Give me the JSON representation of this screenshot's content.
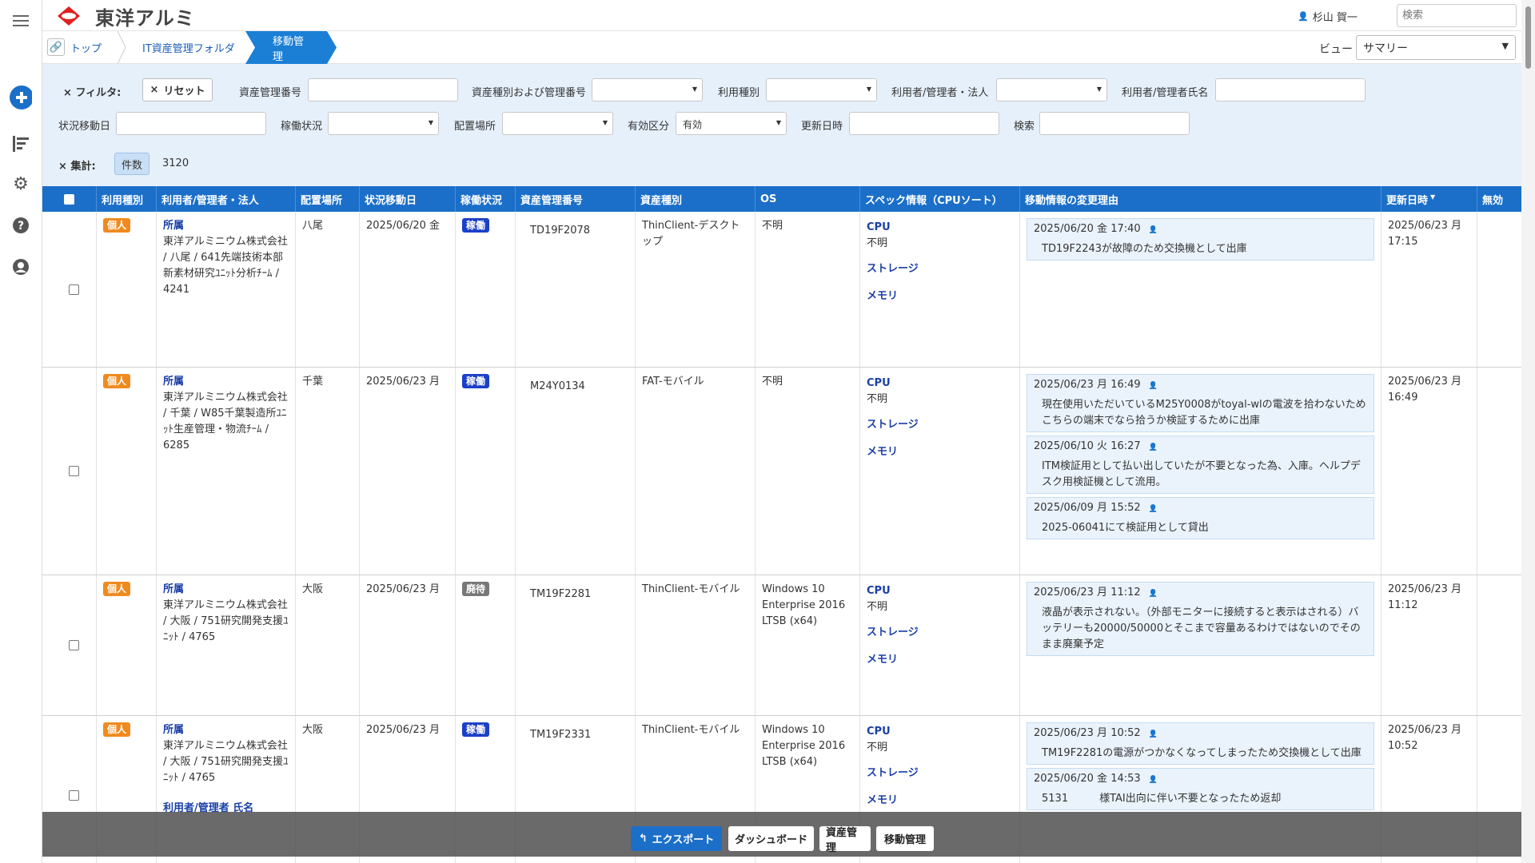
{
  "app": {
    "title": "東洋アルミ",
    "user": "杉山 賀一",
    "search_placeholder": "検索"
  },
  "breadcrumb": [
    "トップ",
    "IT資産管理フォルダ",
    "移動管理"
  ],
  "view": {
    "label": "ビュー",
    "value": "サマリー"
  },
  "filter": {
    "title": "フィルタ:",
    "reset": "リセット",
    "fields": {
      "asset_no": "資産管理番号",
      "type_and_no": "資産種別および管理番号",
      "usage": "利用種別",
      "user_corp": "利用者/管理者・法人",
      "user_name": "利用者/管理者氏名",
      "move_date": "状況移動日",
      "operation": "稼働状況",
      "location": "配置場所",
      "validity": "有効区分",
      "validity_value": "有効",
      "updated": "更新日時",
      "search": "検索"
    },
    "summary_label": "集計:",
    "count_label": "件数",
    "count_value": "3120"
  },
  "columns": [
    "利用種別",
    "利用者/管理者・法人",
    "配置場所",
    "状況移動日",
    "稼働状況",
    "資産管理番号",
    "資産種別",
    "OS",
    "スペック情報（CPUソート）",
    "移動情報の変更理由",
    "更新日時",
    "無効"
  ],
  "spec_labels": {
    "cpu": "CPU",
    "unknown": "不明",
    "storage": "ストレージ",
    "memory": "メモリ"
  },
  "rows": [
    {
      "usage": "個人",
      "affil": "所属",
      "corp": "東洋アルミニウム株式会社 / 八尾 / 641先端技術本部新素材研究ﾕﾆｯﾄ分析ﾁｰﾑ / 4241",
      "extra": "",
      "location": "八尾",
      "date": "2025/06/20 金",
      "status": "稼働",
      "asset_no": "TD19F2078",
      "asset_type": "ThinClient-デスクトップ",
      "os": "不明",
      "history": [
        {
          "date": "2025/06/20 金 17:40",
          "text": "TD19F2243が故障のため交換機として出庫"
        }
      ],
      "updated": "2025/06/23 月 17:15"
    },
    {
      "usage": "個人",
      "affil": "所属",
      "corp": "東洋アルミニウム株式会社 / 千葉 / W85千葉製造所ﾕﾆｯﾄ生産管理・物流ﾁｰﾑ / 6285",
      "extra": "",
      "location": "千葉",
      "date": "2025/06/23 月",
      "status": "稼働",
      "asset_no": "M24Y0134",
      "asset_type": "FAT-モバイル",
      "os": "不明",
      "history": [
        {
          "date": "2025/06/23 月 16:49",
          "text": "現在使用いただいているM25Y0008がtoyal-wlの電波を拾わないためこちらの端末でなら拾うか検証するために出庫"
        },
        {
          "date": "2025/06/10 火 16:27",
          "text": "ITM検証用として払い出していたが不要となった為、入庫。ヘルプデスク用検証機として流用。"
        },
        {
          "date": "2025/06/09 月 15:52",
          "text": "2025-06041にて検証用として貸出"
        }
      ],
      "updated": "2025/06/23 月 16:49"
    },
    {
      "usage": "個人",
      "affil": "所属",
      "corp": "東洋アルミニウム株式会社 / 大阪 / 751研究開発支援ﾕﾆｯﾄ / 4765",
      "extra": "",
      "location": "大阪",
      "date": "2025/06/23 月",
      "status": "廃待",
      "asset_no": "TM19F2281",
      "asset_type": "ThinClient-モバイル",
      "os": "Windows 10 Enterprise 2016 LTSB (x64)",
      "history": [
        {
          "date": "2025/06/23 月 11:12",
          "text": "液晶が表示されない。（外部モニターに接続すると表示はされる）バッテリーも20000/50000とそこまで容量あるわけではないのでそのまま廃棄予定"
        }
      ],
      "updated": "2025/06/23 月 11:12"
    },
    {
      "usage": "個人",
      "affil": "所属",
      "corp": "東洋アルミニウム株式会社 / 大阪 / 751研究開発支援ﾕﾆｯﾄ / 4765",
      "extra": "利用者/管理者 氏名",
      "location": "大阪",
      "date": "2025/06/23 月",
      "status": "稼働",
      "asset_no": "TM19F2331",
      "asset_type": "ThinClient-モバイル",
      "os": "Windows 10 Enterprise 2016 LTSB (x64)",
      "history": [
        {
          "date": "2025/06/23 月 10:52",
          "text": "TM19F2281の電源がつかなくなってしまったため交換機として出庫"
        },
        {
          "date": "2025/06/20 金 14:53",
          "text": "5131　　　様TAI出向に伴い不要となったため返却"
        }
      ],
      "updated": "2025/06/23 月 10:52"
    }
  ],
  "bottom": {
    "export": "エクスポート",
    "dashboard": "ダッシュボード",
    "asset": "資産管理",
    "move": "移動管理"
  },
  "colors": {
    "header_blue": "#1b6fc9",
    "badge_orange": "#f08a1e",
    "badge_blue": "#1b40c8",
    "filter_bg": "#e6f0fb"
  }
}
